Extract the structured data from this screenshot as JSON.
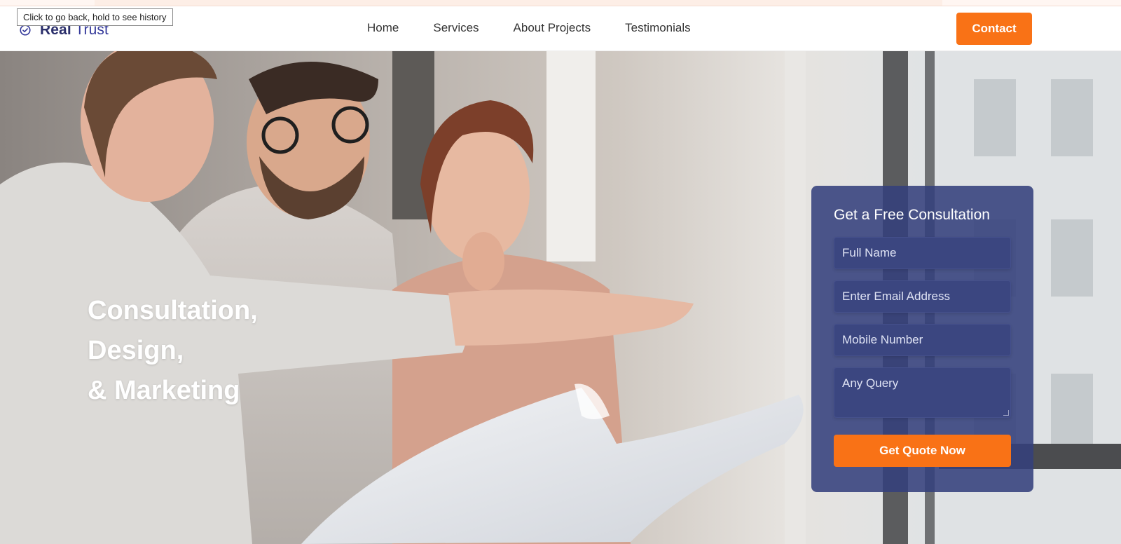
{
  "browser": {
    "tooltip": "Click to go back, hold to see history"
  },
  "header": {
    "logo": {
      "part1": "Real",
      "part2": "Trust",
      "icon": "check-circle-icon"
    },
    "nav": [
      "Home",
      "Services",
      "About Projects",
      "Testimonials"
    ],
    "contact_label": "Contact"
  },
  "hero": {
    "headline": [
      "Consultation,",
      "Design,",
      "& Marketing"
    ],
    "image": "photo-consultants-with-blueprint"
  },
  "form": {
    "title": "Get a Free Consultation",
    "fields": {
      "full_name": "Full Name",
      "email": "Enter Email Address",
      "mobile": "Mobile Number",
      "query": "Any Query"
    },
    "submit_label": "Get Quote Now"
  },
  "colors": {
    "accent": "#f97216",
    "brand": "#2b2f6b",
    "form_bg": "#34407c"
  }
}
